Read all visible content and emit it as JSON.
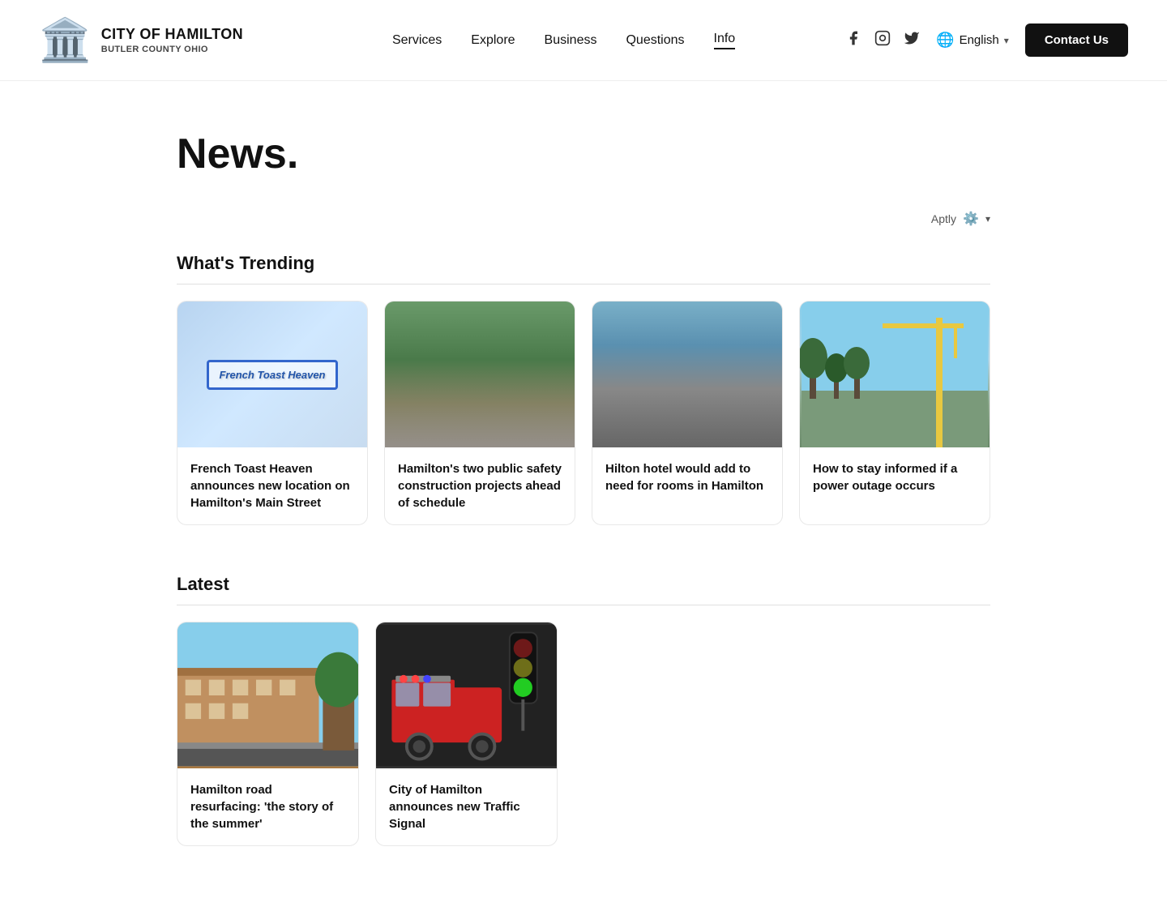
{
  "header": {
    "logo": {
      "city_line1": "City of Hamilton",
      "city_line2": "BUTLER COUNTY Ohio"
    },
    "nav": [
      {
        "label": "Services",
        "active": false
      },
      {
        "label": "Explore",
        "active": false
      },
      {
        "label": "Business",
        "active": false
      },
      {
        "label": "Questions",
        "active": false
      },
      {
        "label": "Info",
        "active": true
      }
    ],
    "language": "English",
    "contact_btn": "Contact Us"
  },
  "page": {
    "title": "News."
  },
  "aptly": {
    "label": "Aptly",
    "badge": "0"
  },
  "trending": {
    "section_title": "What's Trending",
    "cards": [
      {
        "id": 1,
        "title": "French Toast Heaven announces new location on Hamilton's Main Street",
        "image_type": "french-toast"
      },
      {
        "id": 2,
        "title": "Hamilton's two public safety construction projects ahead of schedule",
        "image_type": "construction"
      },
      {
        "id": 3,
        "title": "Hilton hotel would add to need for rooms in Hamilton",
        "image_type": "hilton"
      },
      {
        "id": 4,
        "title": "How to stay informed if a power outage occurs",
        "image_type": "powerline"
      }
    ]
  },
  "latest": {
    "section_title": "Latest",
    "cards": [
      {
        "id": 5,
        "title": "Hamilton road resurfacing: 'the story of the summer'",
        "image_type": "building"
      },
      {
        "id": 6,
        "title": "City of Hamilton announces new Traffic Signal",
        "image_type": "firetruck"
      }
    ]
  }
}
